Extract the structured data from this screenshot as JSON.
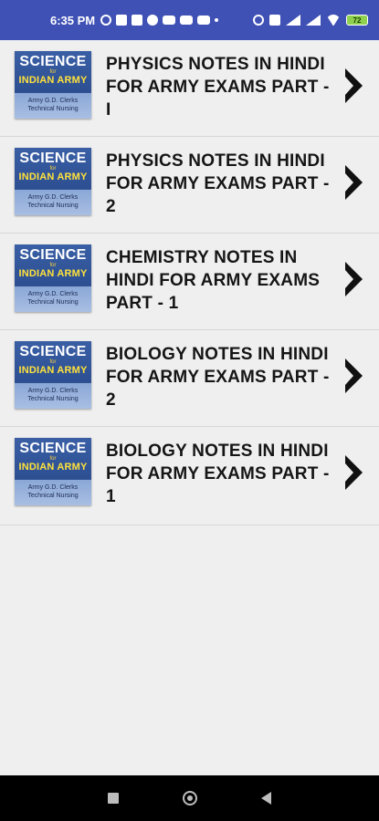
{
  "status_bar": {
    "time": "6:35 PM",
    "battery": "72",
    "left_icons": [
      "gear-icon",
      "notification-icon",
      "notification-icon",
      "facebook-icon",
      "youtube-icon",
      "youtube-icon",
      "youtube-icon",
      "dot-icon"
    ],
    "right_icons": [
      "alarm-icon",
      "volte-icon",
      "signal-icon",
      "signal-icon",
      "wifi-icon",
      "battery-icon"
    ]
  },
  "cover": {
    "title": "SCIENCE",
    "for": "for",
    "subtitle": "INDIAN ARMY",
    "line1": "Army G.D. Clerks",
    "line2": "Technical Nursing"
  },
  "items": [
    {
      "title": "PHYSICS NOTES IN HINDI FOR ARMY EXAMS PART - I"
    },
    {
      "title": "PHYSICS NOTES IN HINDI FOR ARMY EXAMS PART - 2"
    },
    {
      "title": "CHEMISTRY  NOTES IN HINDI FOR ARMY EXAMS PART - 1"
    },
    {
      "title": "BIOLOGY NOTES IN HINDI FOR ARMY EXAMS PART - 2"
    },
    {
      "title": "BIOLOGY NOTES IN HINDI FOR ARMY EXAMS PART - 1"
    }
  ],
  "colors": {
    "status_bar": "#3f51b5",
    "background": "#efefef",
    "cover_blue": "#2d4f92",
    "cover_yellow": "#ffe23b"
  },
  "nav_bar": {
    "icons": [
      "recents-square-icon",
      "home-circle-icon",
      "back-triangle-icon"
    ]
  }
}
